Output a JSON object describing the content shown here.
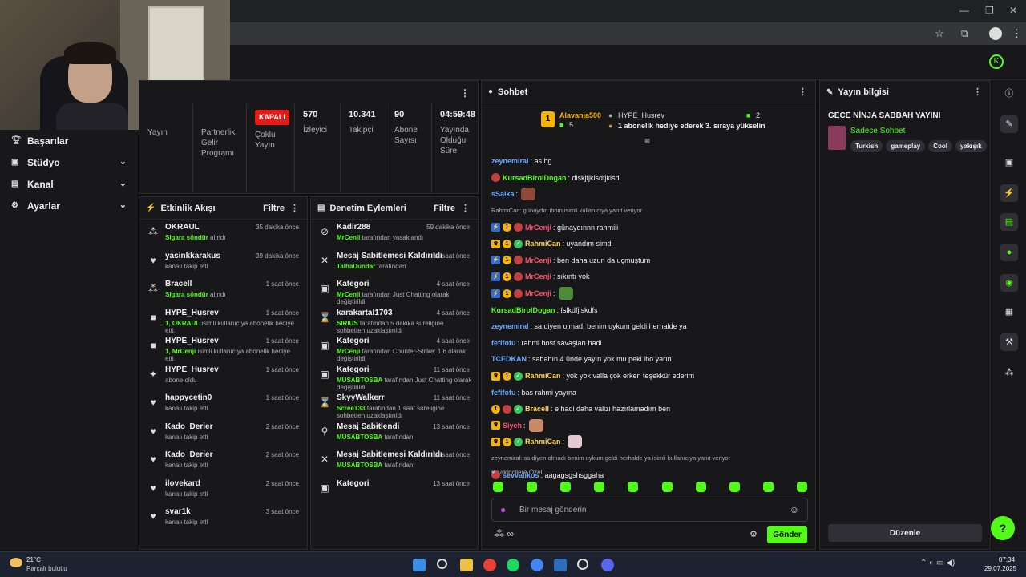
{
  "sidebar": {
    "items": [
      {
        "icon": "trophy-icon",
        "label": "Başarılar",
        "chevron": false
      },
      {
        "icon": "studio-icon",
        "label": "Stüdyo",
        "chevron": true
      },
      {
        "icon": "channel-icon",
        "label": "Kanal",
        "chevron": true
      },
      {
        "icon": "gear-icon",
        "label": "Ayarlar",
        "chevron": true
      }
    ]
  },
  "stats": {
    "col0_label": "Yayın",
    "col1_label": "Partnerlik Gelir Programı",
    "col2_badge": "KAPALI",
    "col2_label": "Çoklu Yayın",
    "col3_value": "570",
    "col3_label": "İzleyici",
    "col4_value": "10.341",
    "col4_label": "Takipçi",
    "col5_value": "90",
    "col5_label": "Abone Sayısı",
    "col6_value": "04:59:48",
    "col6_label": "Yayında Olduğu Süre"
  },
  "activity": {
    "title": "Etkinlik Akışı",
    "filter": "Filtre",
    "items": [
      {
        "icon": "share-icon",
        "name": "OKRAUL",
        "time": "35 dakika önce",
        "g": "Sigara söndür",
        "rest": " alındı"
      },
      {
        "icon": "heart-icon",
        "name": "yasinkkarakus",
        "time": "39 dakika önce",
        "g": "",
        "rest": "kanalı takip etti"
      },
      {
        "icon": "share-icon",
        "name": "Bracell",
        "time": "1 saat önce",
        "g": "Sigara söndür",
        "rest": " alındı"
      },
      {
        "icon": "gift-icon",
        "name": "HYPE_Husrev",
        "time": "1 saat önce",
        "g": "1, OKRAUL",
        "rest": " isimli kullanıcıya abonelik hediye etti."
      },
      {
        "icon": "gift-icon",
        "name": "HYPE_Husrev",
        "time": "1 saat önce",
        "g": "1, MrCenji",
        "rest": " isimli kullanıcıya abonelik hediye etti."
      },
      {
        "icon": "sparkle-icon",
        "name": "HYPE_Husrev",
        "time": "1 saat önce",
        "g": "",
        "rest": "abone oldu"
      },
      {
        "icon": "heart-icon",
        "name": "happycetin0",
        "time": "1 saat önce",
        "g": "",
        "rest": "kanalı takip etti"
      },
      {
        "icon": "heart-icon",
        "name": "Kado_Derier",
        "time": "2 saat önce",
        "g": "",
        "rest": "kanalı takip etti"
      },
      {
        "icon": "heart-icon",
        "name": "Kado_Derier",
        "time": "2 saat önce",
        "g": "",
        "rest": "kanalı takip etti"
      },
      {
        "icon": "heart-icon",
        "name": "ilovekard",
        "time": "2 saat önce",
        "g": "",
        "rest": "kanalı takip etti"
      },
      {
        "icon": "heart-icon",
        "name": "svar1k",
        "time": "3 saat önce",
        "g": "",
        "rest": "kanalı takip etti"
      }
    ]
  },
  "moderation": {
    "title": "Denetim Eylemleri",
    "filter": "Filtre",
    "items": [
      {
        "icon": "ban-icon",
        "name": "Kadir288",
        "time": "59 dakika önce",
        "g": "MrCenji",
        "rest": " tarafından yasaklandı"
      },
      {
        "icon": "unpin-icon",
        "name": "Mesaj Sabitlemesi Kaldırıldı",
        "time": "13 saat önce",
        "g": "TalhaDundar",
        "rest": " tarafından"
      },
      {
        "icon": "category-icon",
        "name": "Kategori",
        "time": "4 saat önce",
        "g": "MrCenji",
        "rest": " tarafından Just Chatting olarak değiştirildi"
      },
      {
        "icon": "timeout-icon",
        "name": "karakartal1703",
        "time": "4 saat önce",
        "g": "SIRIUS",
        "rest": " tarafından 5 dakika süreliğine sohbetten uzaklaştırıldı"
      },
      {
        "icon": "category-icon",
        "name": "Kategori",
        "time": "4 saat önce",
        "g": "MrCenji",
        "rest": " tarafından Counter-Strike: 1.6 olarak değiştirildi"
      },
      {
        "icon": "category-icon",
        "name": "Kategori",
        "time": "11 saat önce",
        "g": "MUSABTOSBA",
        "rest": " tarafından Just Chatting olarak değiştirildi"
      },
      {
        "icon": "timeout-icon",
        "name": "SkyyWalkerr",
        "time": "11 saat önce",
        "g": "ScreeT33",
        "rest": " tarafından 1 saat süreliğine sohbetten uzaklaştırıldı"
      },
      {
        "icon": "pin-icon",
        "name": "Mesaj Sabitlendi",
        "time": "13 saat önce",
        "g": "MUSABTOSBA",
        "rest": " tarafından"
      },
      {
        "icon": "unpin-icon",
        "name": "Mesaj Sabitlemesi Kaldırıldı",
        "time": "13 saat önce",
        "g": "MUSABTOSBA",
        "rest": " tarafından"
      },
      {
        "icon": "category-icon",
        "name": "Kategori",
        "time": "13 saat önce",
        "g": "",
        "rest": ""
      }
    ]
  },
  "chat": {
    "title": "Sohbet",
    "pinned": {
      "user": "Alavanja500",
      "count": "5",
      "gifter": "HYPE_Husrev",
      "gift_count": "2",
      "text": "1 abonelik hediye ederek 3. sıraya yükselin"
    },
    "messages": [
      {
        "user": "zeynemiral",
        "color": "#6aa9ff",
        "badges": [],
        "text": ": as hg"
      },
      {
        "user": "KursadBirolDogan",
        "color": "#53fc18",
        "badges": [
          "red"
        ],
        "text": ": dlskjfjklsdfjklsd"
      },
      {
        "user": "sSaika",
        "color": "#6aa9ff",
        "badges": [],
        "text": ":",
        "emote": "#8b4a3a"
      },
      {
        "reply": "RahmiCan: günaydın ibom isimli kullanıcıya yanıt veriyor"
      },
      {
        "user": "MrCenji",
        "color": "#ff4f6d",
        "badges": [
          "sub",
          "one",
          "red"
        ],
        "text": ": günaydınnn rahmiii"
      },
      {
        "user": "RahmiCan",
        "color": "#ffd54a",
        "badges": [
          "crown",
          "one",
          "grn"
        ],
        "text": ": uyandım simdi"
      },
      {
        "user": "MrCenji",
        "color": "#ff4f6d",
        "badges": [
          "sub",
          "one",
          "red"
        ],
        "text": ": ben daha uzun da uçmuştum"
      },
      {
        "user": "MrCenji",
        "color": "#ff4f6d",
        "badges": [
          "sub",
          "one",
          "red"
        ],
        "text": ": sıkıntı yok"
      },
      {
        "user": "MrCenji",
        "color": "#ff4f6d",
        "badges": [
          "sub",
          "one",
          "red"
        ],
        "text": ":",
        "emote": "#4f8a3a"
      },
      {
        "user": "KursadBirolDogan",
        "color": "#53fc18",
        "badges": [],
        "text": ": fslkdfjlskdfs"
      },
      {
        "user": "zeynemiral",
        "color": "#6aa9ff",
        "badges": [],
        "text": ": sa diyen olmadı benim uykum geldi herhalde ya"
      },
      {
        "user": "fefifofu",
        "color": "#6aa9ff",
        "badges": [],
        "text": ": rahmi host savaşları hadi"
      },
      {
        "user": "TCEDKAN",
        "color": "#6aa9ff",
        "badges": [],
        "text": ": sabahın 4 ünde yayın yok mu peki ibo yarın"
      },
      {
        "user": "RahmiCan",
        "color": "#ffd54a",
        "badges": [
          "crown",
          "one",
          "grn"
        ],
        "text": ": yok yok valla çok erken teşekkür ederim"
      },
      {
        "user": "fefifofu",
        "color": "#6aa9ff",
        "badges": [],
        "text": ": bas rahmi yayına"
      },
      {
        "user": "Bracell",
        "color": "#ffd54a",
        "badges": [
          "one",
          "red",
          "grn"
        ],
        "text": ": e hadi daha valizi hazırlamadım ben"
      },
      {
        "user": "Siyeh",
        "color": "#ff4f6d",
        "badges": [
          "crown"
        ],
        "text": ":",
        "emote": "#c98a6a"
      },
      {
        "user": "RahmiCan",
        "color": "#ffd54a",
        "badges": [
          "crown",
          "one",
          "grn"
        ],
        "text": ":",
        "emote": "#e6c8d0"
      },
      {
        "reply": "zeynemiral: sa diyen olmadı benim uykum geldi herhalde ya isimli kullanıcıya yanıt veriyor"
      },
      {
        "user": "sevvalikos",
        "color": "#6aa9ff",
        "badges": [
          "red"
        ],
        "text": ": aagagsgshsggaha"
      }
    ],
    "followers_only": "Takipçilere Özel",
    "input_placeholder": "Bir mesaj gönderin",
    "send": "Gönder"
  },
  "stream_info": {
    "title": "Yayın bilgisi",
    "stream_title": "GECE NİNJA SABBAH YAYINI",
    "category": "Sadece Sohbet",
    "tags": [
      "Turkish",
      "gameplay",
      "Cool",
      "yakışık"
    ],
    "edit": "Düzenle"
  },
  "taskbar": {
    "temp": "21°C",
    "weather": "Parçalı bulutlu",
    "time": "07:34",
    "date": "29.07.2025"
  },
  "colors": {
    "accent": "#53fc18",
    "panel": "#18181b",
    "bg": "#0e0e10"
  }
}
